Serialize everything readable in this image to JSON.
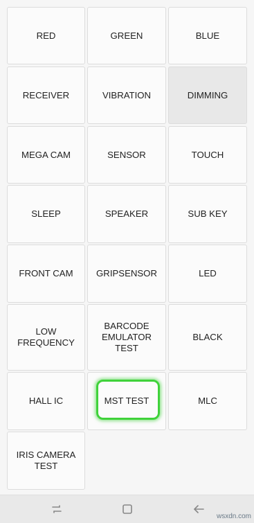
{
  "tests": [
    {
      "label": "RED"
    },
    {
      "label": "GREEN"
    },
    {
      "label": "BLUE"
    },
    {
      "label": "RECEIVER"
    },
    {
      "label": "VIBRATION"
    },
    {
      "label": "DIMMING"
    },
    {
      "label": "MEGA CAM"
    },
    {
      "label": "SENSOR"
    },
    {
      "label": "TOUCH"
    },
    {
      "label": "SLEEP"
    },
    {
      "label": "SPEAKER"
    },
    {
      "label": "SUB KEY"
    },
    {
      "label": "FRONT CAM"
    },
    {
      "label": "GRIPSENSOR"
    },
    {
      "label": "LED"
    },
    {
      "label": "LOW FREQUENCY"
    },
    {
      "label_line1": "BARCODE",
      "label_line2": "EMULATOR TEST"
    },
    {
      "label": "BLACK"
    },
    {
      "label": "HALL IC"
    },
    {
      "label": "MST TEST"
    },
    {
      "label": "MLC"
    },
    {
      "label": "IRIS CAMERA TEST"
    }
  ],
  "active_test": "DIMMING",
  "highlighted_test": "MST TEST",
  "highlight_color": "#3fd23a",
  "navbar": {
    "icons": [
      "recent-apps-icon",
      "home-icon",
      "back-icon"
    ]
  },
  "watermark": "wsxdn.com"
}
